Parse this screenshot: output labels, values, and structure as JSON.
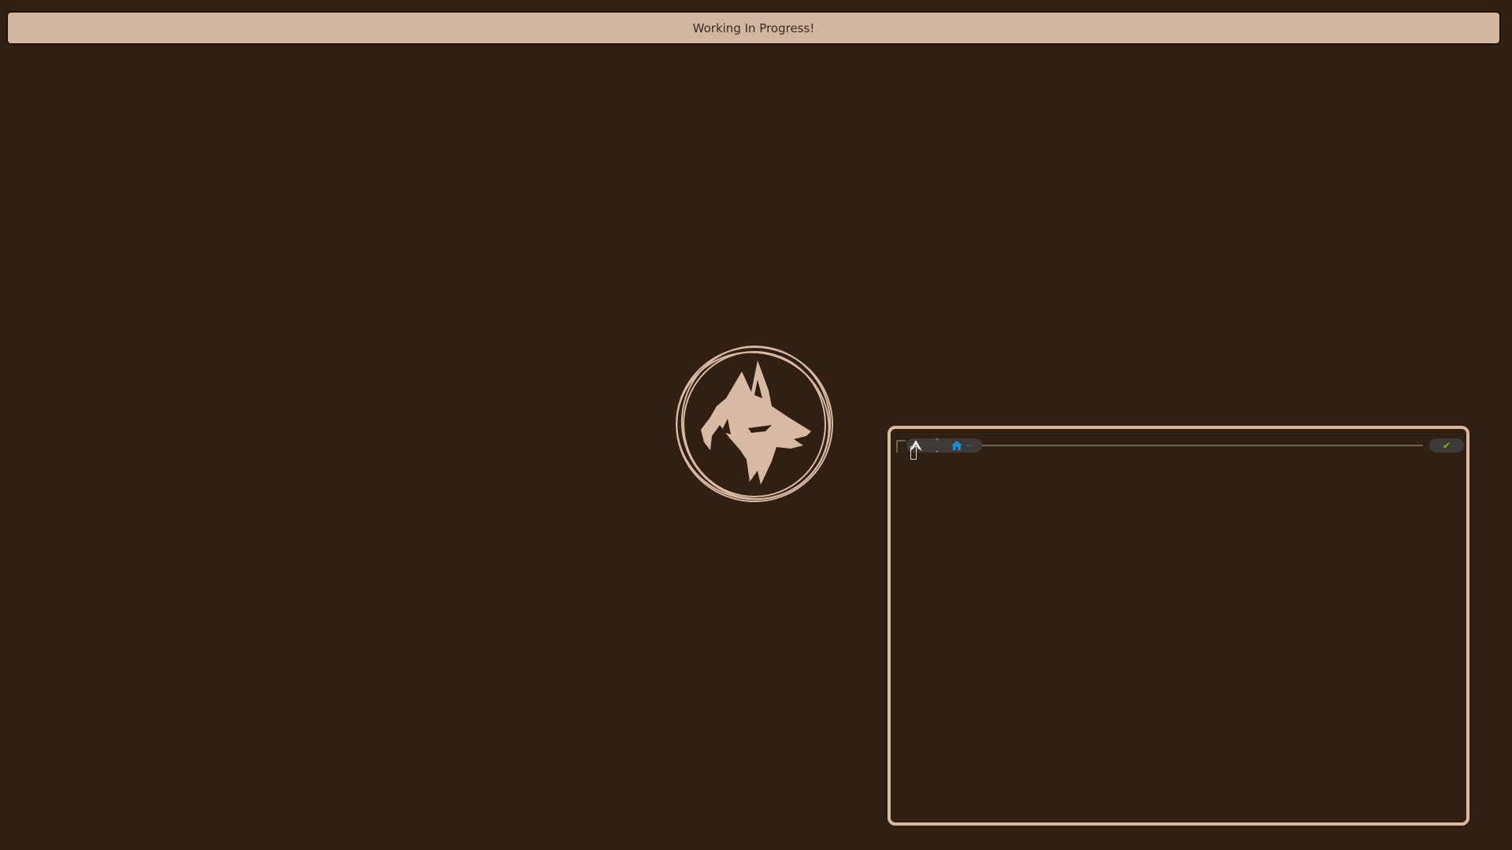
{
  "topbar": {
    "text": "Working In Progress!"
  },
  "desktop": {
    "logo_icon": "wolf-emblem-icon"
  },
  "terminal": {
    "os_icon": "arch-linux-icon",
    "dir_icon": "home-icon",
    "directory": "~",
    "status_icon": "check-icon",
    "status_text": "✔"
  },
  "colors": {
    "background": "#321f14",
    "accent": "#d3b6a2",
    "dir_color": "#1a8cd1",
    "status_ok": "#6cc01c"
  }
}
